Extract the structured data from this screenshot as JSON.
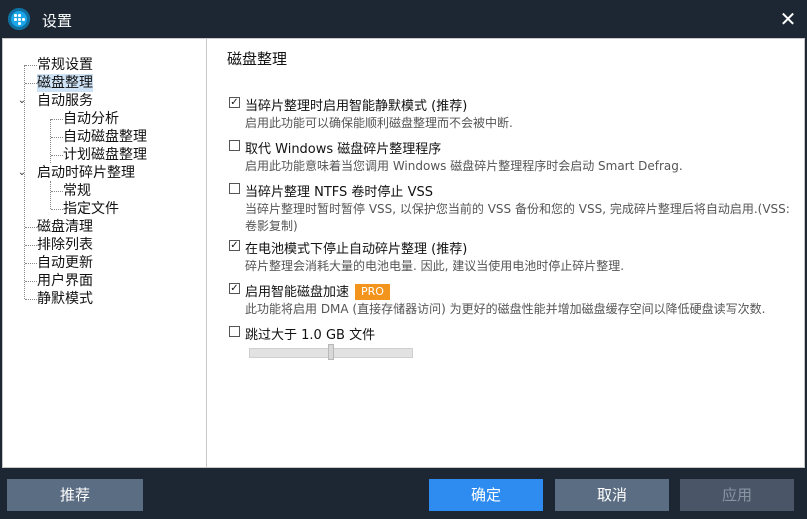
{
  "window": {
    "title": "设置",
    "app_icon": "iobit-smart-defrag-icon"
  },
  "tree": {
    "items": [
      {
        "label": "常规设置",
        "level": 0
      },
      {
        "label": "磁盘整理",
        "level": 0,
        "selected": true
      },
      {
        "label": "自动服务",
        "level": 0,
        "expanded": true
      },
      {
        "label": "自动分析",
        "level": 1
      },
      {
        "label": "自动磁盘整理",
        "level": 1
      },
      {
        "label": "计划磁盘整理",
        "level": 1
      },
      {
        "label": "启动时碎片整理",
        "level": 0,
        "expanded": true
      },
      {
        "label": "常规",
        "level": 1
      },
      {
        "label": "指定文件",
        "level": 1
      },
      {
        "label": "磁盘清理",
        "level": 0
      },
      {
        "label": "排除列表",
        "level": 0
      },
      {
        "label": "自动更新",
        "level": 0
      },
      {
        "label": "用户界面",
        "level": 0
      },
      {
        "label": "静默模式",
        "level": 0
      }
    ]
  },
  "content": {
    "heading": "磁盘整理",
    "options": [
      {
        "label": "当碎片整理时启用智能静默模式 (推荐)",
        "checked": true,
        "desc": "启用此功能可以确保能顺利磁盘整理而不会被中断."
      },
      {
        "label": "取代 Windows 磁盘碎片整理程序",
        "checked": false,
        "desc": "启用此功能意味着当您调用 Windows 磁盘碎片整理程序时会启动 Smart Defrag."
      },
      {
        "label": "当碎片整理 NTFS 卷时停止 VSS",
        "checked": false,
        "desc": "当碎片整理时暂时暂停 VSS, 以保护您当前的 VSS 备份和您的 VSS, 完成碎片整理后将自动启用.(VSS: 卷影复制)"
      },
      {
        "label": "在电池模式下停止自动碎片整理 (推荐)",
        "checked": true,
        "desc": "碎片整理会消耗大量的电池电量. 因此, 建议当使用电池时停止碎片整理."
      },
      {
        "label": "启用智能磁盘加速",
        "checked": true,
        "badge": "PRO",
        "desc": "此功能将启用 DMA (直接存储器访问) 为更好的磁盘性能并增加磁盘缓存空间以降低硬盘读写次数."
      },
      {
        "label": "跳过大于 1.0 GB 文件",
        "checked": false,
        "desc": ""
      }
    ],
    "slider_fraction": 0.5
  },
  "footer": {
    "recommend": "推荐",
    "ok": "确定",
    "cancel": "取消",
    "apply": "应用"
  },
  "colors": {
    "titlebar": "#1c2733",
    "accent": "#2e8cf0",
    "pro_badge": "#f3941c",
    "selection": "#cfe3f6"
  }
}
